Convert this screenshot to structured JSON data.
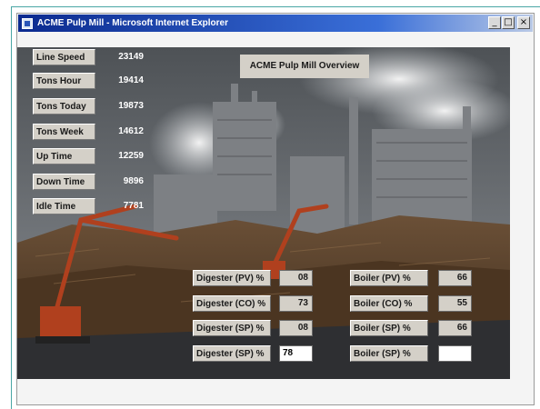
{
  "window": {
    "title": "ACME Pulp Mill - Microsoft Internet Explorer",
    "buttons": {
      "minimize": "_",
      "maximize": "□",
      "close": "×"
    }
  },
  "overview_title": "ACME Pulp Mill Overview",
  "stats": [
    {
      "label": "Line Speed",
      "value": "23149"
    },
    {
      "label": "Tons Hour",
      "value": "19414"
    },
    {
      "label": "Tons Today",
      "value": "19873"
    },
    {
      "label": "Tons Week",
      "value": "14612"
    },
    {
      "label": "Up Time",
      "value": "12259"
    },
    {
      "label": "Down Time",
      "value": "9896"
    },
    {
      "label": "Idle Time",
      "value": "7781"
    }
  ],
  "digester": [
    {
      "label": "Digester (PV) %",
      "value": "08"
    },
    {
      "label": "Digester (CO) %",
      "value": "73"
    },
    {
      "label": "Digester (SP) %",
      "value": "08"
    },
    {
      "label": "Digester (SP) %",
      "input_value": "78"
    }
  ],
  "boiler": [
    {
      "label": "Boiler (PV) %",
      "value": "66"
    },
    {
      "label": "Boiler (CO) %",
      "value": "55"
    },
    {
      "label": "Boiler (SP) %",
      "value": "66"
    },
    {
      "label": "Boiler (SP) %",
      "input_value": ""
    }
  ],
  "colors": {
    "titlebar_start": "#0b2a8f",
    "titlebar_end": "#b9c9e6",
    "panel_gray": "#d4d0c8"
  }
}
